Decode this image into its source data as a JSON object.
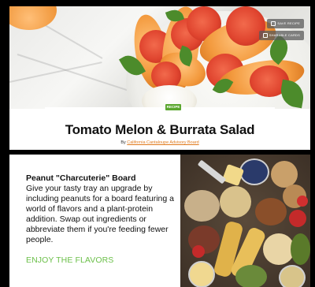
{
  "recipe_card": {
    "badge": "RECIPE",
    "title": "Tomato Melon & Burrata Salad",
    "byline_prefix": "By",
    "author": "California Cantaloupe Advisory Board",
    "actions": [
      "SAVE RECIPE",
      "SHARABLE CARDS"
    ]
  },
  "promo_card": {
    "title": "Peanut \"Charcuterie\" Board",
    "body": "Give your tasty tray an upgrade by including peanuts for a board featuring a world of flavors and a plant-protein addition. Swap out ingredients or abbreviate them if you're feeding fewer people.",
    "cta": "ENJOY THE FLAVORS"
  },
  "colors": {
    "accent_orange": "#e07b1f",
    "accent_green": "#6cc04a",
    "badge_green": "#5aa62e"
  }
}
